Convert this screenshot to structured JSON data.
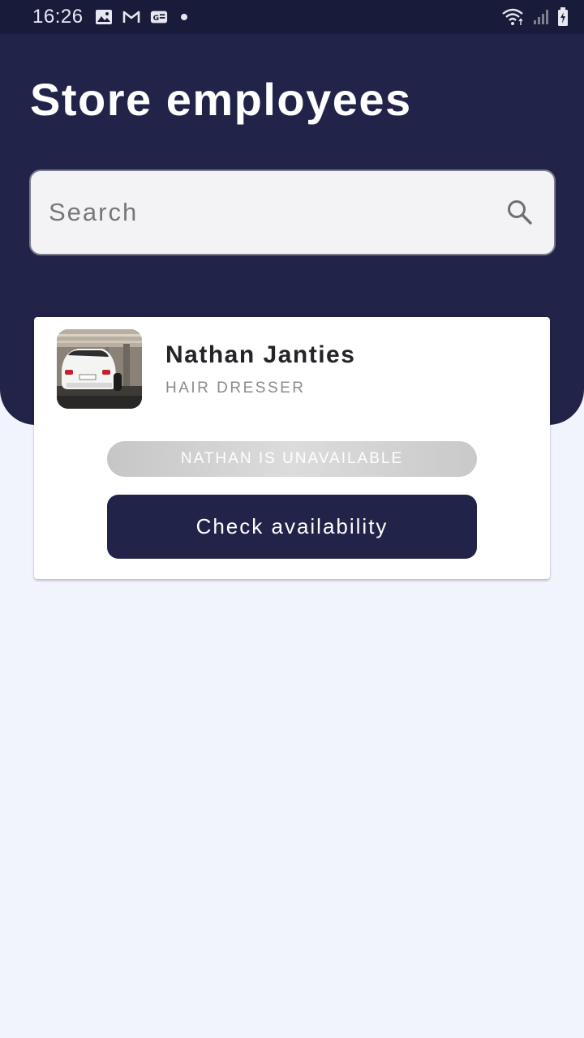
{
  "status_bar": {
    "time": "16:26",
    "left_icons": [
      "gallery-icon",
      "gmail-icon",
      "news-icon",
      "dot-icon"
    ],
    "right_icons": [
      "wifi-icon",
      "signal-icon",
      "battery-icon"
    ]
  },
  "header": {
    "title": "Store employees"
  },
  "search": {
    "placeholder": "Search",
    "value": ""
  },
  "employees": [
    {
      "name": "Nathan Janties",
      "role": "HAIR DRESSER",
      "availability_status": "NATHAN IS UNAVAILABLE",
      "action_label": "Check availability"
    }
  ],
  "colors": {
    "primary": "#212349",
    "status_bar": "#191b3a",
    "background": "#f1f3fd",
    "unavailable_pill": "#d0d0d0"
  }
}
